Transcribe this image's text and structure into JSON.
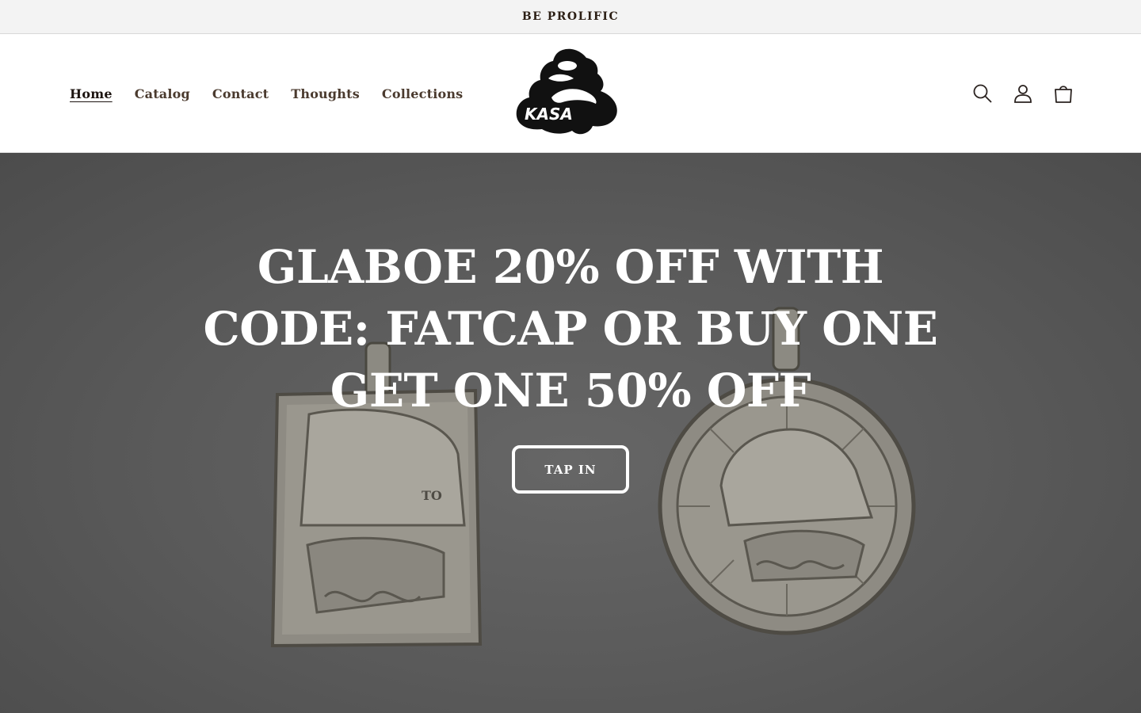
{
  "announcement": {
    "text": "BE PROLIFIC"
  },
  "nav": {
    "items": [
      {
        "label": "Home",
        "active": true
      },
      {
        "label": "Catalog"
      },
      {
        "label": "Contact"
      },
      {
        "label": "Thoughts"
      },
      {
        "label": "Collections"
      }
    ]
  },
  "logo": {
    "text": "KASA"
  },
  "header_icons": [
    "search-icon",
    "account-icon",
    "cart-icon"
  ],
  "hero": {
    "heading": "GLABOE 20% OFF WITH CODE: FATCAP OR BUY ONE GET ONE 50% OFF",
    "button_label": "TAP IN",
    "pendant_engraving": "TO"
  },
  "colors": {
    "announcement_bg": "#f3f3f3",
    "hero_bg": "#5a5a5a",
    "text_dark": "#2b1e14",
    "white": "#ffffff"
  }
}
